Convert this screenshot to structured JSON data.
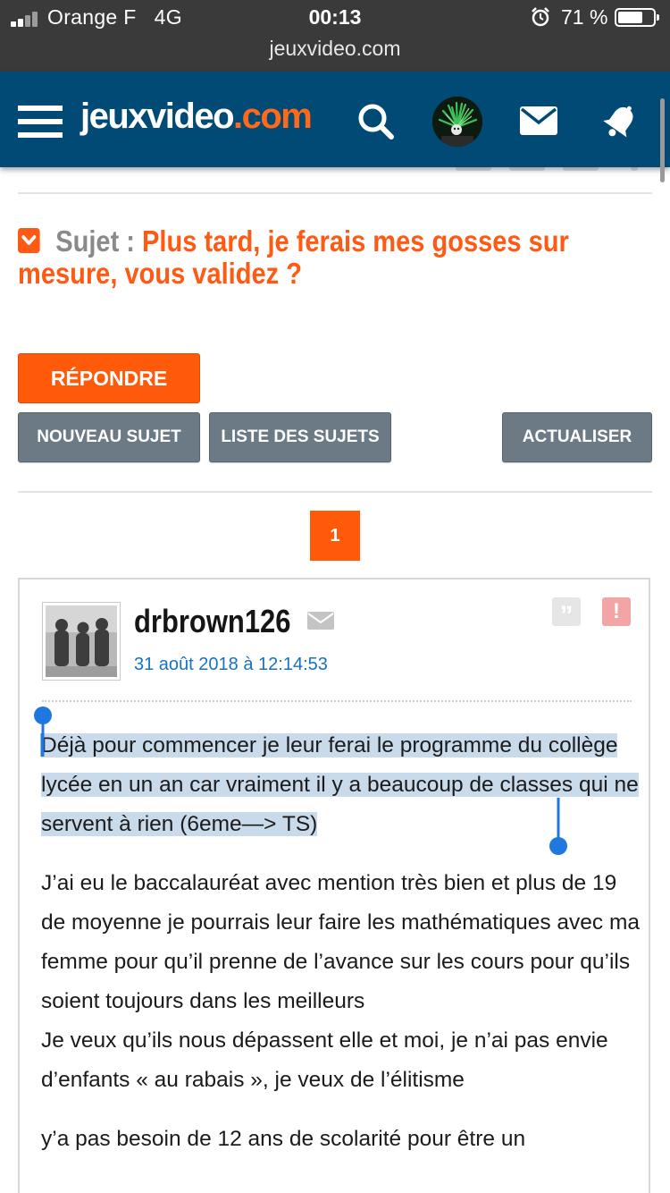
{
  "status_bar": {
    "carrier": "Orange F",
    "network": "4G",
    "time": "00:13",
    "url": "jeuxvideo.com",
    "battery": "71 %",
    "battery_level": 0.71
  },
  "header": {
    "logo_main": "jeuxvideo",
    "logo_suffix": ".com",
    "accent": "#ff6a1a",
    "background": "#004a75"
  },
  "topic": {
    "label": "Sujet :",
    "title": "Plus tard, je ferais mes gosses sur mesure, vous validez ?"
  },
  "buttons": {
    "reply": "RÉPONDRE",
    "new_topic": "NOUVEAU SUJET",
    "topic_list": "LISTE DES SUJETS",
    "refresh": "ACTUALISER"
  },
  "pagination": {
    "current_page": "1"
  },
  "post": {
    "author": "drbrown126",
    "date": "31 août 2018 à 12:14:53",
    "quote_symbol": "”",
    "alert_symbol": "!",
    "paragraph_1": "Déjà pour commencer je leur ferai le programme du collège lycée en un an car vraiment il y a beaucoup de classes qui ne servent à rien (6eme—> TS)",
    "paragraph_2": "J’ai eu le baccalauréat avec mention très bien et plus de 19 de moyenne je pourrais leur faire les mathématiques avec ma femme pour qu’il prenne de l’avance sur les cours pour qu’ils soient toujours dans les meilleurs",
    "paragraph_2b": "Je veux qu’ils nous dépassent elle et moi, je n’ai pas envie d’enfants « au rabais », je veux de l’élitisme",
    "paragraph_3": "y’a pas besoin de 12 ans de scolarité pour être un"
  },
  "colors": {
    "selection": "#c9daea",
    "cursor": "#1f78e0",
    "grey_button": "#6b7a85",
    "date_link": "#1672c4"
  }
}
